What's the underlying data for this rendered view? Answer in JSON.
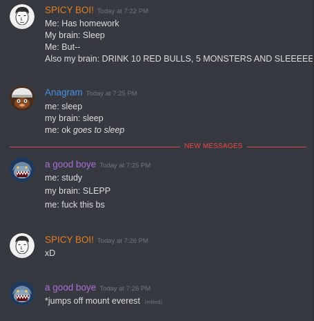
{
  "colors": {
    "background": "#36393f",
    "text": "#dcddde",
    "timestamp": "#72767d",
    "new_messages": "#f04747",
    "spicy_name": "#e67e22",
    "anagram_name": "#4a90e2",
    "boye_name": "#a970d8"
  },
  "divider": {
    "label": "NEW MESSAGES"
  },
  "messages": [
    {
      "author": "SPICY BOI!",
      "timestamp": "Today at 7:22 PM",
      "avatar_icon": "cartoon-face-avatar",
      "lines": [
        "Me: Has homework",
        "My brain: Sleep",
        "Me: But--",
        "Also my brain: DRINK 10 RED BULLS, 5 MONSTERS AND SLEEEEEP"
      ]
    },
    {
      "author": "Anagram",
      "timestamp": "Today at 7:25 PM",
      "avatar_icon": "hat-character-avatar",
      "lines": [
        "me: sleep",
        "my brain: sleep",
        "me: ok "
      ],
      "italic_tail": "goes to sleep"
    },
    {
      "author": "a good boye",
      "timestamp": "Today at 7:25 PM",
      "avatar_icon": "snarling-creature-avatar",
      "lines": [
        "me: study",
        "my brain: SLEPP",
        "me: fuck this bs"
      ]
    },
    {
      "author": "SPICY BOI!",
      "timestamp": "Today at 7:26 PM",
      "avatar_icon": "cartoon-face-avatar",
      "lines": [
        "xD"
      ]
    },
    {
      "author": "a good boye",
      "timestamp": "Today at 7:26 PM",
      "avatar_icon": "snarling-creature-avatar",
      "lines": [
        "*jumps off mount everest "
      ],
      "edited_label": "(edited)"
    }
  ]
}
